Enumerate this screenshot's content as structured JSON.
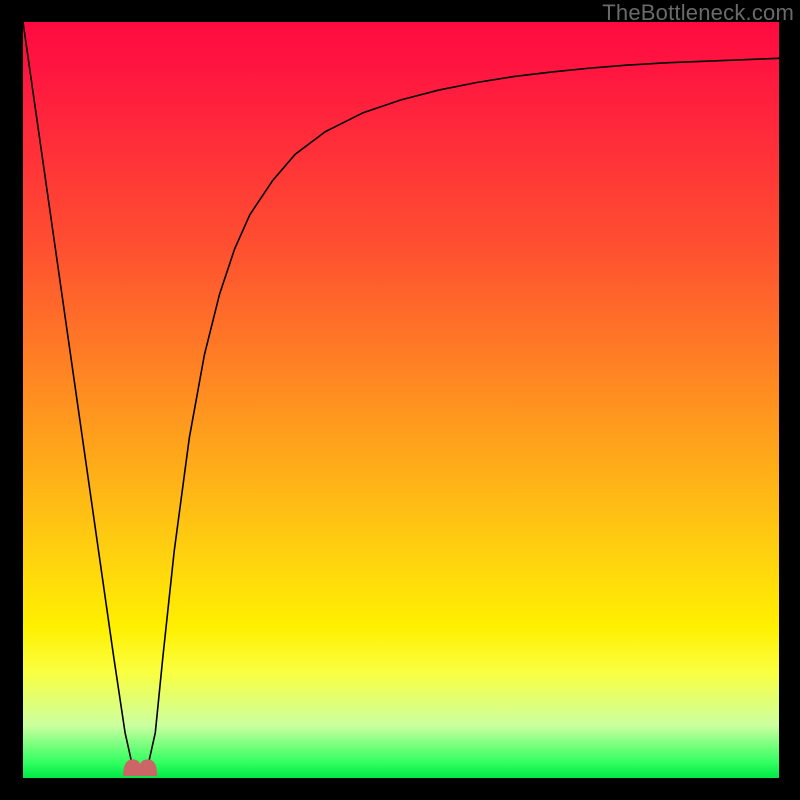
{
  "attribution": "TheBottleneck.com",
  "colors": {
    "background": "#000000",
    "curve_stroke": "#000000",
    "bump_fill": "#cc6666",
    "gradient_top": "#ff0a40",
    "gradient_bottom": "#00e848"
  },
  "chart_data": {
    "type": "line",
    "title": "",
    "xlabel": "",
    "ylabel": "",
    "xlim": [
      0,
      100
    ],
    "ylim": [
      0,
      100
    ],
    "x": [
      0,
      2,
      4,
      6,
      8,
      10,
      12,
      13.5,
      14.5,
      15.5,
      16.5,
      17.5,
      18.5,
      20,
      22,
      24,
      26,
      28,
      30,
      33,
      36,
      40,
      45,
      50,
      55,
      60,
      65,
      70,
      75,
      80,
      85,
      90,
      95,
      100
    ],
    "values": [
      100,
      86,
      72,
      58,
      44,
      30,
      16,
      6,
      1.5,
      0.8,
      1.5,
      6,
      16,
      30,
      45,
      56,
      64,
      70,
      74.5,
      79,
      82.5,
      85.5,
      88,
      89.7,
      91,
      92,
      92.8,
      93.4,
      93.9,
      94.3,
      94.6,
      94.8,
      95,
      95.2
    ],
    "valley_marker": {
      "x_center": 15.5,
      "width": 4.5,
      "height_pct": 2.2
    }
  }
}
